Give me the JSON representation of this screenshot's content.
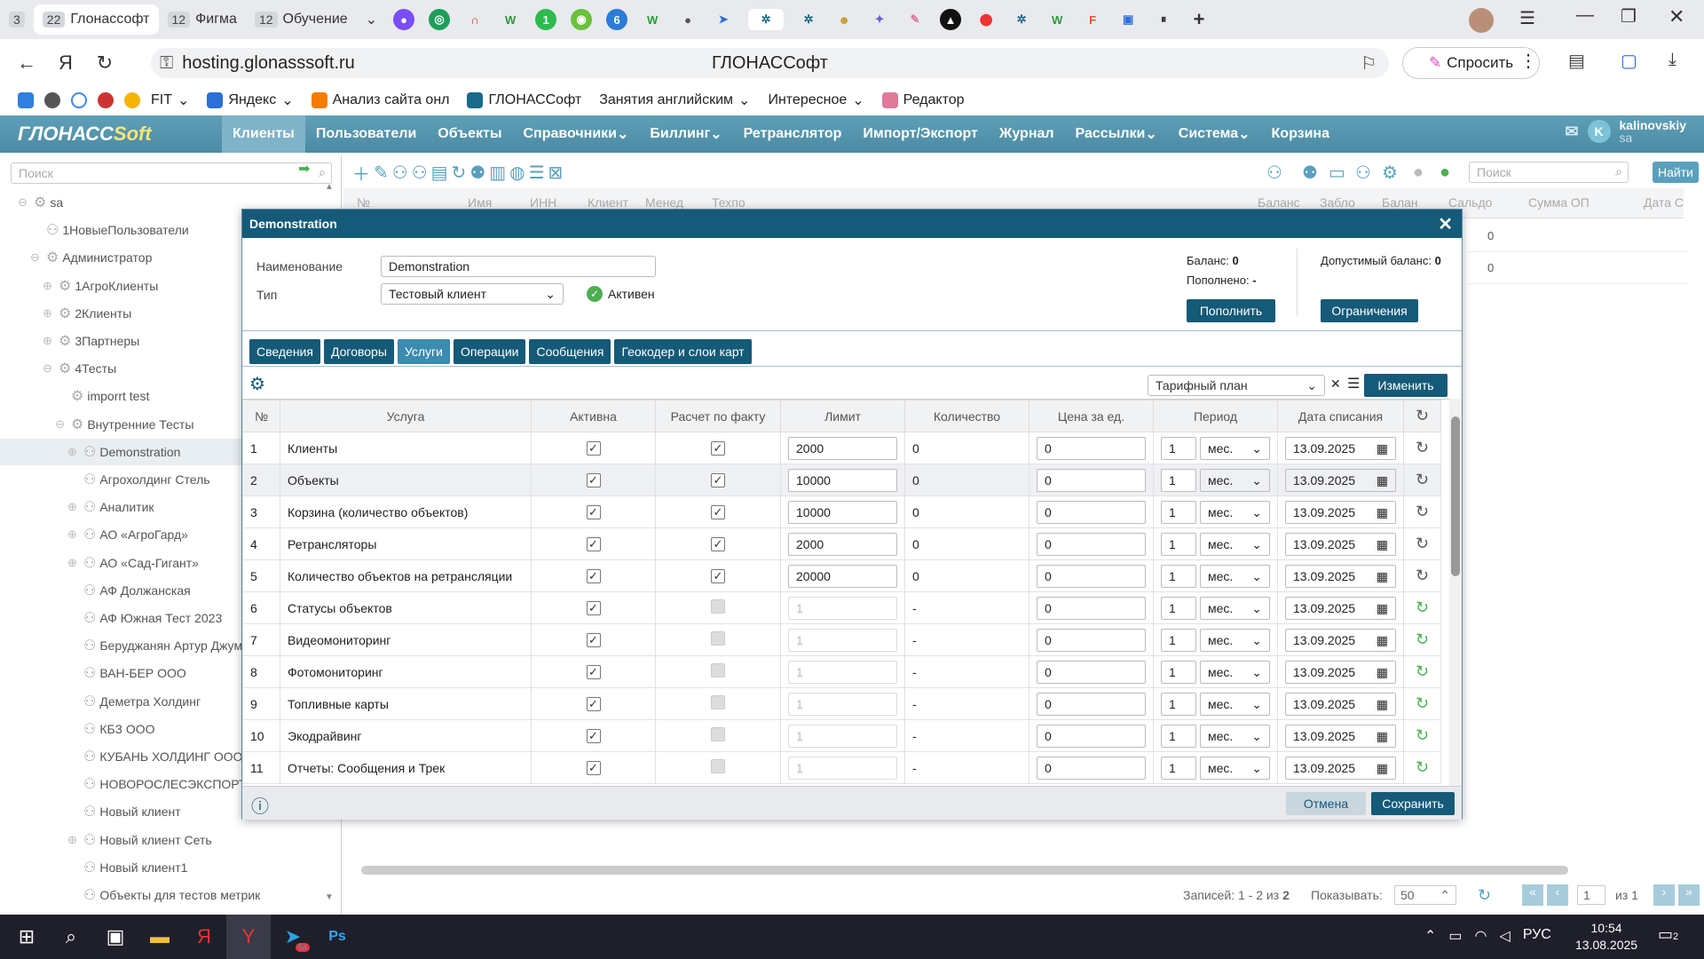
{
  "browser": {
    "tabs": [
      {
        "count": "3",
        "label": ""
      },
      {
        "count": "22",
        "label": "Глонассофт",
        "selected": true
      },
      {
        "count": "12",
        "label": "Фигма"
      },
      {
        "count": "12",
        "label": "Обучение"
      }
    ],
    "url": "hosting.glonasssoft.ru",
    "page_title": "ГЛОНАССофт",
    "ask_button": "Спросить",
    "bookmarks": [
      "FIT",
      "Яндекс",
      "Анализ сайта онл",
      "ГЛОНАССофт",
      "Занятия английским",
      "Интересное",
      "Редактор"
    ]
  },
  "app": {
    "logo_main": "ГЛОНАСС",
    "logo_soft": "Soft",
    "menu": [
      "Клиенты",
      "Пользователи",
      "Объекты",
      "Справочники",
      "Биллинг",
      "Ретранслятор",
      "Импорт/Экспорт",
      "Журнал",
      "Рассылки",
      "Система",
      "Корзина"
    ],
    "user_name": "kalinovskiy",
    "user_role": "sa",
    "user_initial": "K"
  },
  "tree": {
    "search_placeholder": "Поиск",
    "nodes": [
      {
        "label": "sa",
        "level": 0
      },
      {
        "label": "1НовыеПользователи",
        "level": 1
      },
      {
        "label": "Администратор",
        "level": 1
      },
      {
        "label": "1АгроКлиенты",
        "level": 2
      },
      {
        "label": "2Клиенты",
        "level": 2
      },
      {
        "label": "3Партнеры",
        "level": 2
      },
      {
        "label": "4Тесты",
        "level": 2
      },
      {
        "label": "imporrt test",
        "level": 3
      },
      {
        "label": "Внутренние Тесты",
        "level": 3
      },
      {
        "label": "Demonstration",
        "level": 4,
        "selected": true
      },
      {
        "label": "Агрохолдинг Стель",
        "level": 4
      },
      {
        "label": "Аналитик",
        "level": 4
      },
      {
        "label": "АО «АгроГард»",
        "level": 4
      },
      {
        "label": "АО «Сад-Гигант»",
        "level": 4
      },
      {
        "label": "АФ Должанская",
        "level": 4
      },
      {
        "label": "АФ Южная Тест 2023",
        "level": 4
      },
      {
        "label": "Беруджанян Артур Джумбер",
        "level": 4
      },
      {
        "label": "ВАН-БЕР ООО",
        "level": 4
      },
      {
        "label": "Деметра Холдинг",
        "level": 4
      },
      {
        "label": "КБЗ ООО",
        "level": 4
      },
      {
        "label": "КУБАНЬ ХОЛДИНГ ООО",
        "level": 4
      },
      {
        "label": "НОВОРОСЛЕСЭКСПОРТ",
        "level": 4
      },
      {
        "label": "Новый клиент",
        "level": 4
      },
      {
        "label": "Новый клиент Сеть",
        "level": 4
      },
      {
        "label": "Новый клиент1",
        "level": 4
      },
      {
        "label": "Объекты для тестов метрик",
        "level": 4
      }
    ]
  },
  "right": {
    "search_placeholder": "Поиск",
    "find_button": "Найти",
    "columns": [
      "№",
      "Имя",
      "ИНН",
      "Клиент",
      "Менед",
      "Техпо",
      "Баланс",
      "Забло",
      "Балан",
      "Сальдо",
      "Сумма ОП",
      "Дата С"
    ],
    "row_values": [
      "0",
      "0"
    ],
    "footer_records": "Записей: 1 - 2 из",
    "footer_total": "2",
    "footer_show": "Показывать:",
    "footer_page_size": "50",
    "footer_page": "1",
    "footer_of": "из 1"
  },
  "modal": {
    "title": "Demonstration",
    "name_label": "Наименование",
    "name_value": "Demonstration",
    "type_label": "Тип",
    "type_value": "Тестовый клиент",
    "active_label": "Активен",
    "balance_label": "Баланс:",
    "balance_value": "0",
    "replenished_label": "Пополнено:",
    "replenished_value": "-",
    "allowed_label": "Допустимый баланс:",
    "allowed_value": "0",
    "topup_button": "Пополнить",
    "limits_button": "Ограничения",
    "tabs": [
      "Сведения",
      "Договоры",
      "Услуги",
      "Операции",
      "Сообщения",
      "Геокодер и слои карт"
    ],
    "tariff_placeholder": "Тарифный план",
    "change_button": "Изменить",
    "headers": [
      "№",
      "Услуга",
      "Активна",
      "Расчет по факту",
      "Лимит",
      "Количество",
      "Цена за ед.",
      "Период",
      "Дата списания"
    ],
    "rows": [
      {
        "n": "1",
        "service": "Клиенты",
        "active": true,
        "fact": true,
        "limit": "2000",
        "qty": "0",
        "price": "0",
        "period": "1",
        "unit": "мес.",
        "date": "13.09.2025"
      },
      {
        "n": "2",
        "service": "Объекты",
        "active": true,
        "fact": true,
        "limit": "10000",
        "qty": "0",
        "price": "0",
        "period": "1",
        "unit": "мес.",
        "date": "13.09.2025"
      },
      {
        "n": "3",
        "service": "Корзина (количество объектов)",
        "active": true,
        "fact": true,
        "limit": "10000",
        "qty": "0",
        "price": "0",
        "period": "1",
        "unit": "мес.",
        "date": "13.09.2025"
      },
      {
        "n": "4",
        "service": "Ретрансляторы",
        "active": true,
        "fact": true,
        "limit": "2000",
        "qty": "0",
        "price": "0",
        "period": "1",
        "unit": "мес.",
        "date": "13.09.2025"
      },
      {
        "n": "5",
        "service": "Количество объектов на ретрансляции",
        "active": true,
        "fact": true,
        "limit": "20000",
        "qty": "0",
        "price": "0",
        "period": "1",
        "unit": "мес.",
        "date": "13.09.2025"
      },
      {
        "n": "6",
        "service": "Статусы объектов",
        "active": true,
        "fact": false,
        "limit": "1",
        "qty": "-",
        "price": "0",
        "period": "1",
        "unit": "мес.",
        "date": "13.09.2025"
      },
      {
        "n": "7",
        "service": "Видеомониторинг",
        "active": true,
        "fact": false,
        "limit": "1",
        "qty": "-",
        "price": "0",
        "period": "1",
        "unit": "мес.",
        "date": "13.09.2025"
      },
      {
        "n": "8",
        "service": "Фотомониторинг",
        "active": true,
        "fact": false,
        "limit": "1",
        "qty": "-",
        "price": "0",
        "period": "1",
        "unit": "мес.",
        "date": "13.09.2025"
      },
      {
        "n": "9",
        "service": "Топливные карты",
        "active": true,
        "fact": false,
        "limit": "1",
        "qty": "-",
        "price": "0",
        "period": "1",
        "unit": "мес.",
        "date": "13.09.2025"
      },
      {
        "n": "10",
        "service": "Экодрайвинг",
        "active": true,
        "fact": false,
        "limit": "1",
        "qty": "-",
        "price": "0",
        "period": "1",
        "unit": "мес.",
        "date": "13.09.2025"
      },
      {
        "n": "11",
        "service": "Отчеты: Сообщения и Трек",
        "active": true,
        "fact": false,
        "limit": "1",
        "qty": "-",
        "price": "0",
        "period": "1",
        "unit": "мес.",
        "date": "13.09.2025"
      }
    ],
    "cancel_button": "Отмена",
    "save_button": "Сохранить"
  },
  "taskbar": {
    "lang": "РУС",
    "time": "10:54",
    "date": "13.08.2025",
    "notif": "2",
    "telegram_badge": "54"
  }
}
